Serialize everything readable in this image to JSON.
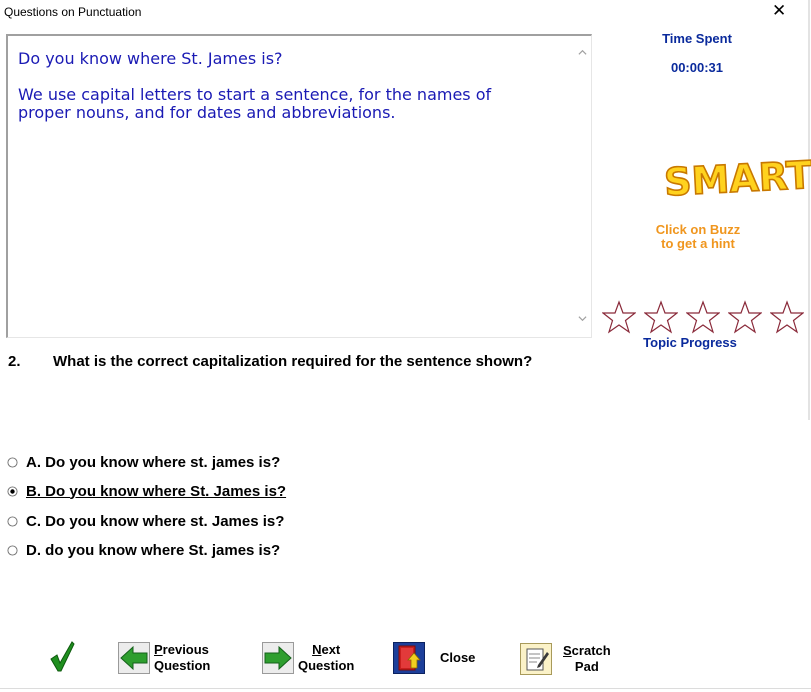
{
  "window": {
    "title": "Questions on Punctuation",
    "close_glyph": "✕"
  },
  "passage": {
    "paragraphs": [
      "Do you know where St. James is?",
      "We use capital letters to start a sentence, for the names of\nproper nouns, and for dates and abbreviations."
    ],
    "text_color": "#1a1ab4"
  },
  "timer": {
    "label": "Time Spent",
    "value": "00:00:31"
  },
  "logo": {
    "text": "SMART",
    "colors": {
      "fill": "#ffd21e",
      "outline": "#c87800"
    }
  },
  "hint": {
    "text": "Click on Buzz\nto get a hint",
    "color": "#f0961e"
  },
  "progress": {
    "label": "Topic Progress",
    "stars_total": 5,
    "stars_filled": 0
  },
  "question": {
    "number": "2.",
    "text": "What is the correct capitalization required for the sentence shown?",
    "options": [
      {
        "text": "A. Do you know where st. james is?",
        "selected": false
      },
      {
        "text": "B. Do you know where St. James is?",
        "selected": true
      },
      {
        "text": "C. Do you know where st. James is?",
        "selected": false
      },
      {
        "text": "D. do you know where St. james is?",
        "selected": false
      }
    ]
  },
  "toolbar": {
    "check_icon": "checkmark-icon",
    "previous": {
      "accesskey": "P",
      "line1_rest": "revious",
      "line2": "Question",
      "icon": "left-arrow-icon"
    },
    "next": {
      "accesskey": "N",
      "line1_rest": "ext",
      "line2": "Question",
      "icon": "right-arrow-icon"
    },
    "close": {
      "label": "Close",
      "icon": "exit-door-icon"
    },
    "scratch": {
      "accesskey": "S",
      "line1_rest": "cratch",
      "line2": "Pad",
      "icon": "notepad-icon"
    }
  },
  "colors": {
    "accent_blue": "#0a2a9c",
    "arrow_green": "#2e9e2e",
    "check_green": "#1f8f1f"
  }
}
